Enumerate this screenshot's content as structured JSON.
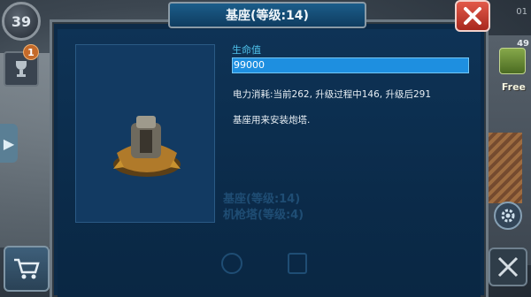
{
  "hud": {
    "level": "39",
    "trophy_badge": "1",
    "top_right_text": "01",
    "resource_count": "49",
    "free_label": "Free"
  },
  "modal": {
    "title": "基座(等级:14)",
    "close_label": "X",
    "stats": {
      "health_label": "生命值",
      "health_value": "99000"
    },
    "power_text": "电力消耗:当前262, 升级过程中146, 升级后291",
    "description": "基座用来安装炮塔.",
    "ghost_line_1": "基座(等级:14)",
    "ghost_line_2": "机枪塔(等级:4)"
  },
  "colors": {
    "accent": "#1e8fe0",
    "label": "#4fc1ea",
    "close": "#c0392b"
  }
}
